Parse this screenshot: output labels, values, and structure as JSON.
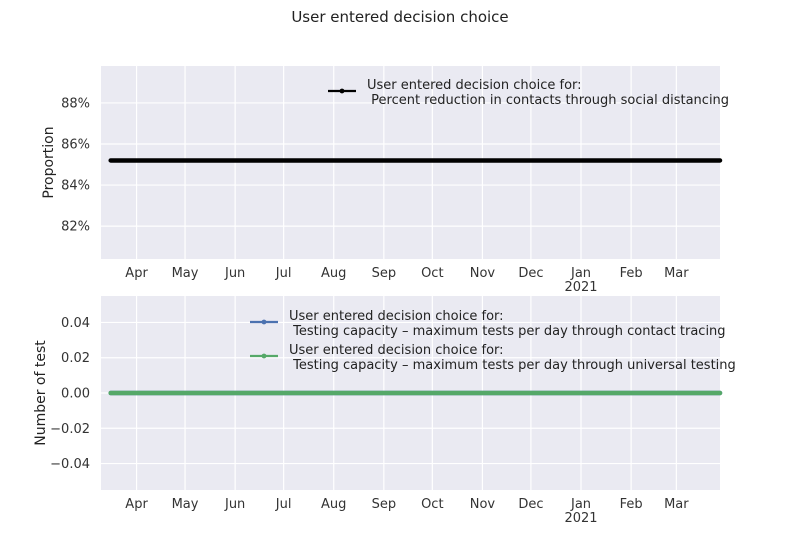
{
  "figure": {
    "title": "User entered decision choice"
  },
  "chart_data": [
    {
      "type": "line",
      "title": "",
      "xlabel": "",
      "ylabel": "Proportion",
      "x_ticks": [
        "Apr",
        "May",
        "Jun",
        "Jul",
        "Aug",
        "Sep",
        "Oct",
        "Nov",
        "Dec",
        "Jan",
        "Feb",
        "Mar"
      ],
      "x_tick_year": "2021",
      "x_range": [
        "2020-03-10",
        "2021-03-28"
      ],
      "ylim": [
        0.804,
        0.898
      ],
      "y_ticks": [
        "82%",
        "84%",
        "86%",
        "88%"
      ],
      "y_tick_values": [
        0.82,
        0.84,
        0.86,
        0.88
      ],
      "grid": true,
      "legend_position": "top-right",
      "series": [
        {
          "name": "User entered decision choice for:\n Percent reduction in contacts through social distancing",
          "color": "#000000",
          "x": [
            "2020-03-16",
            "2021-03-28"
          ],
          "y": [
            0.852,
            0.852
          ]
        }
      ]
    },
    {
      "type": "line",
      "title": "",
      "xlabel": "",
      "ylabel": "Number of test",
      "x_ticks": [
        "Apr",
        "May",
        "Jun",
        "Jul",
        "Aug",
        "Sep",
        "Oct",
        "Nov",
        "Dec",
        "Jan",
        "Feb",
        "Mar"
      ],
      "x_tick_year": "2021",
      "x_range": [
        "2020-03-10",
        "2021-03-28"
      ],
      "ylim": [
        -0.055,
        0.055
      ],
      "y_ticks": [
        "0.04",
        "0.02",
        "0.00",
        "−0.02",
        "−0.04"
      ],
      "y_tick_values": [
        0.04,
        0.02,
        0.0,
        -0.02,
        -0.04
      ],
      "grid": true,
      "legend_position": "top-center",
      "series": [
        {
          "name": "User entered decision choice for:\n Testing capacity – maximum tests per day through contact tracing",
          "color": "#4c72b0",
          "x": [
            "2020-03-16",
            "2021-03-28"
          ],
          "y": [
            0,
            0
          ]
        },
        {
          "name": "User entered decision choice for:\n Testing capacity – maximum tests per day through universal testing",
          "color": "#55a868",
          "x": [
            "2020-03-16",
            "2021-03-28"
          ],
          "y": [
            0,
            0
          ]
        }
      ]
    }
  ]
}
